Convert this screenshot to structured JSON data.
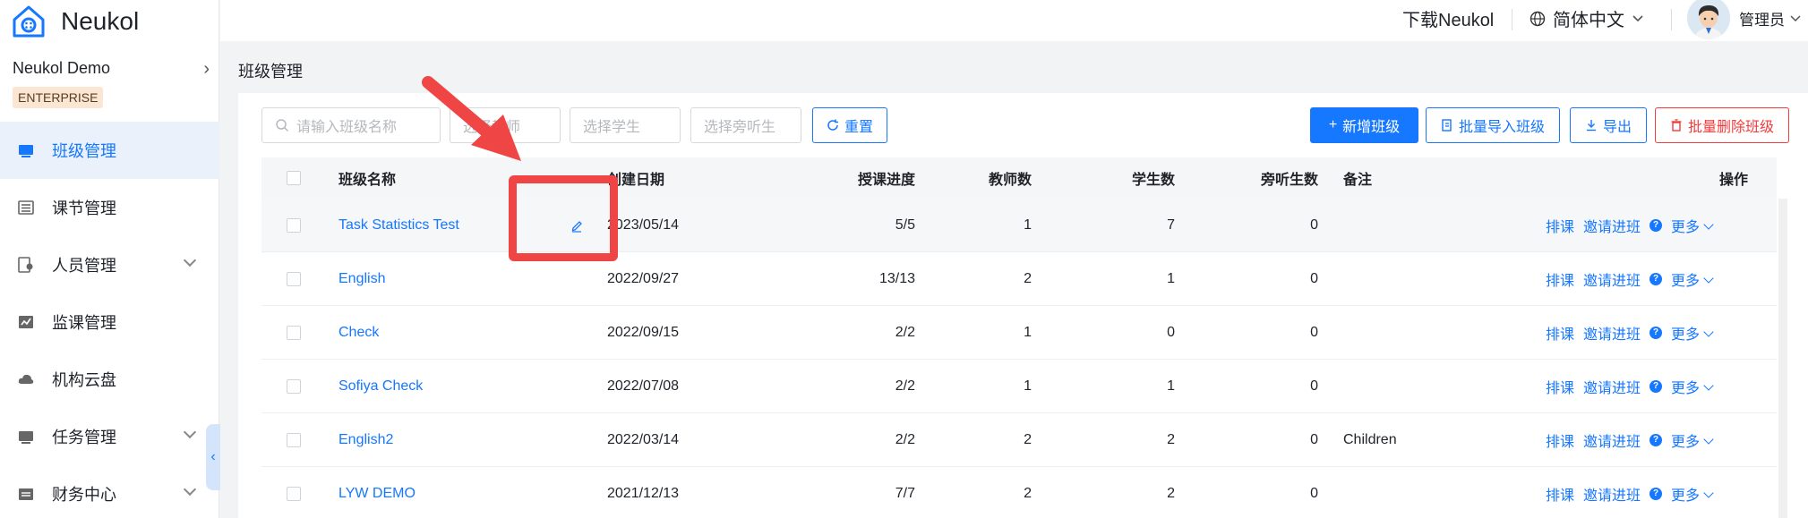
{
  "app": {
    "name": "Neukol"
  },
  "org": {
    "name": "Neukol Demo",
    "badge": "ENTERPRISE"
  },
  "sidebar": {
    "items": [
      {
        "label": "班级管理",
        "icon": "class-icon",
        "active": true
      },
      {
        "label": "课节管理",
        "icon": "lesson-icon"
      },
      {
        "label": "人员管理",
        "icon": "people-icon",
        "expandable": true
      },
      {
        "label": "监课管理",
        "icon": "monitor-chart-icon"
      },
      {
        "label": "机构云盘",
        "icon": "cloud-icon"
      },
      {
        "label": "任务管理",
        "icon": "task-icon",
        "expandable": true
      },
      {
        "label": "财务中心",
        "icon": "finance-icon",
        "expandable": true
      }
    ]
  },
  "header": {
    "download": "下载Neukol",
    "language": "简体中文",
    "user": "管理员"
  },
  "page": {
    "title": "班级管理"
  },
  "filters": {
    "class_name_placeholder": "请输入班级名称",
    "teacher_placeholder": "选择教师",
    "student_placeholder": "选择学生",
    "auditor_placeholder": "选择旁听生",
    "reset": "重置"
  },
  "actions": {
    "add": "新增班级",
    "import": "批量导入班级",
    "export": "导出",
    "batch_delete": "批量删除班级"
  },
  "table": {
    "headers": {
      "name": "班级名称",
      "date": "创建日期",
      "progress": "授课进度",
      "teachers": "教师数",
      "students": "学生数",
      "auditors": "旁听生数",
      "note": "备注",
      "ops": "操作"
    },
    "op_labels": {
      "schedule": "排课",
      "invite": "邀请进班",
      "help": "?",
      "more": "更多"
    },
    "rows": [
      {
        "name": "Task Statistics Test",
        "date": "2023/05/14",
        "progress": "5/5",
        "teachers": "1",
        "students": "7",
        "auditors": "0",
        "note": ""
      },
      {
        "name": "English",
        "date": "2022/09/27",
        "progress": "13/13",
        "teachers": "2",
        "students": "1",
        "auditors": "0",
        "note": ""
      },
      {
        "name": "Check",
        "date": "2022/09/15",
        "progress": "2/2",
        "teachers": "1",
        "students": "0",
        "auditors": "0",
        "note": ""
      },
      {
        "name": "Sofiya Check",
        "date": "2022/07/08",
        "progress": "2/2",
        "teachers": "1",
        "students": "1",
        "auditors": "0",
        "note": ""
      },
      {
        "name": "English2",
        "date": "2022/03/14",
        "progress": "2/2",
        "teachers": "2",
        "students": "2",
        "auditors": "0",
        "note": "Children"
      },
      {
        "name": "LYW DEMO",
        "date": "2021/12/13",
        "progress": "7/7",
        "teachers": "2",
        "students": "2",
        "auditors": "0",
        "note": ""
      }
    ]
  },
  "colors": {
    "accent": "#1677ff",
    "danger": "#f23b3b",
    "annotation": "#ef4545"
  }
}
